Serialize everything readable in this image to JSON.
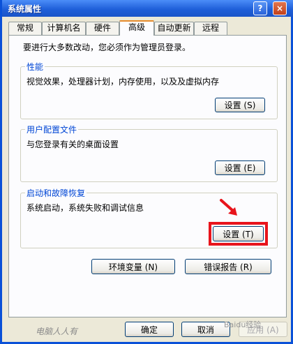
{
  "window": {
    "title": "系统属性",
    "help_glyph": "?",
    "close_glyph": "×"
  },
  "tabs": [
    {
      "label": "常规"
    },
    {
      "label": "计算机名"
    },
    {
      "label": "硬件"
    },
    {
      "label": "高级",
      "active": true
    },
    {
      "label": "自动更新"
    },
    {
      "label": "远程"
    }
  ],
  "note": "要进行大多数改动，您必须作为管理员登录。",
  "groups": {
    "performance": {
      "title": "性能",
      "description": "视觉效果，处理器计划，内存使用，以及及虚拟内存",
      "button": "设置 (S)"
    },
    "user_profiles": {
      "title": "用户配置文件",
      "description": "与您登录有关的桌面设置",
      "button": "设置 (E)"
    },
    "startup_recovery": {
      "title": "启动和故障恢复",
      "description": "系统启动，系统失败和调试信息",
      "button": "设置 (T)"
    }
  },
  "buttons": {
    "env_vars": "环境变量 (N)",
    "error_report": "错误报告 (R)",
    "ok": "确定",
    "cancel": "取消",
    "apply": "应用 (A)"
  },
  "watermarks": {
    "left": "电脑人人有",
    "right": "Baidu经验"
  },
  "colors": {
    "highlight": "#e8141b",
    "legend_blue": "#0046d5",
    "title_bar": "#1f5fd9"
  }
}
